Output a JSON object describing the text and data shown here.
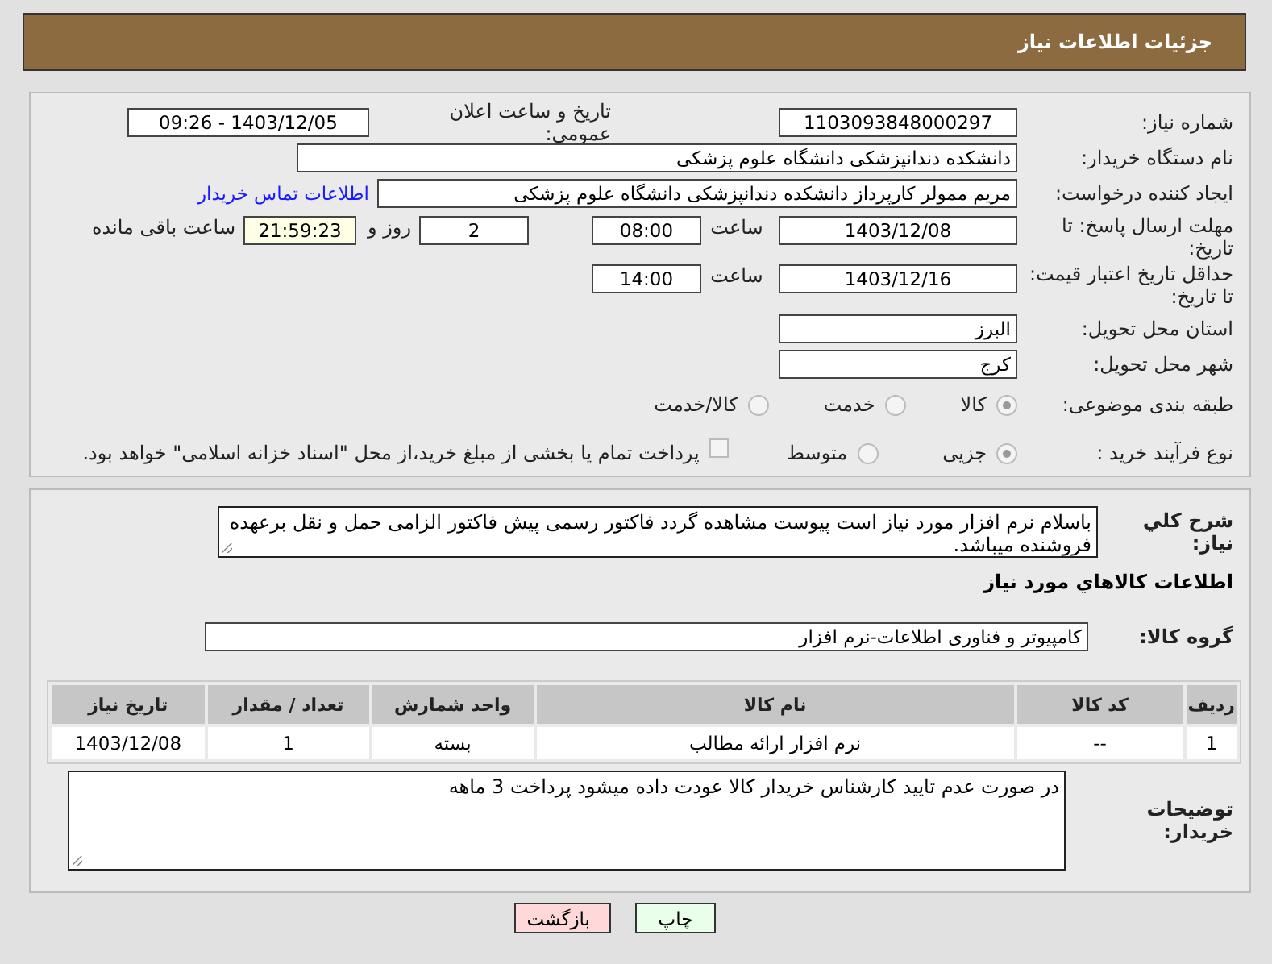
{
  "header": {
    "title": "جزئیات اطلاعات نیاز"
  },
  "need_number": {
    "label": "شماره نیاز:",
    "value": "1103093848000297"
  },
  "announce": {
    "label": "تاریخ و ساعت اعلان عمومی:",
    "value": "1403/12/05 - 09:26"
  },
  "buyer_org": {
    "label": "نام دستگاه خریدار:",
    "value": "دانشکده دندانپزشکی دانشگاه علوم پزشکی"
  },
  "requester": {
    "label": "ایجاد کننده درخواست:",
    "value": "مریم ممولر کارپرداز دانشکده دندانپزشکی دانشگاه علوم پزشکی",
    "link": "اطلاعات تماس خریدار"
  },
  "reply_deadline": {
    "label": "مهلت ارسال پاسخ: تا تاریخ:",
    "date": "1403/12/08",
    "time_label": "ساعت",
    "time": "08:00",
    "days": "2",
    "days_label": "روز و",
    "remaining": "21:59:23",
    "remaining_label": "ساعت باقی مانده"
  },
  "price_validity": {
    "label": "حداقل تاریخ اعتبار قیمت: تا تاریخ:",
    "date": "1403/12/16",
    "time_label": "ساعت",
    "time": "14:00"
  },
  "province": {
    "label": "استان محل تحویل:",
    "value": "البرز"
  },
  "city": {
    "label": "شهر محل تحویل:",
    "value": "کرج"
  },
  "category": {
    "label": "طبقه بندی موضوعی:",
    "options": [
      {
        "label": "کالا",
        "selected": true
      },
      {
        "label": "خدمت",
        "selected": false
      },
      {
        "label": "کالا/خدمت",
        "selected": false
      }
    ]
  },
  "process": {
    "label": "نوع فرآیند خرید :",
    "options": [
      {
        "label": "جزیی",
        "selected": true
      },
      {
        "label": "متوسط",
        "selected": false
      }
    ],
    "treasury": {
      "label": "پرداخت تمام یا بخشی از مبلغ خرید،از محل \"اسناد خزانه اسلامی\" خواهد بود.",
      "checked": false
    }
  },
  "description": {
    "label": "شرح كلي نياز:",
    "value": "باسلام نرم افزار مورد نیاز است پیوست مشاهده گردد فاکتور رسمی پیش فاکتور الزامی حمل و نقل برعهده فروشنده میباشد."
  },
  "goods_heading": "اطلاعات كالاهاي مورد نياز",
  "goods_group": {
    "label": "گروه کالا:",
    "value": "کامپیوتر و فناوری اطلاعات-نرم افزار"
  },
  "table": {
    "columns": [
      "ردیف",
      "کد کالا",
      "نام کالا",
      "واحد شمارش",
      "تعداد / مقدار",
      "تاریخ نیاز"
    ],
    "rows": [
      [
        "1",
        "--",
        "نرم افزار ارائه مطالب",
        "بسته",
        "1",
        "1403/12/08"
      ]
    ]
  },
  "buyer_notes": {
    "label": "توضیحات خریدار:",
    "value": "در صورت عدم تایید کارشناس خریدار کالا عودت داده میشود پرداخت 3 ماهه"
  },
  "buttons": [
    {
      "label": "چاپ",
      "kind": "print"
    },
    {
      "label": "بازگشت",
      "kind": "back"
    }
  ]
}
